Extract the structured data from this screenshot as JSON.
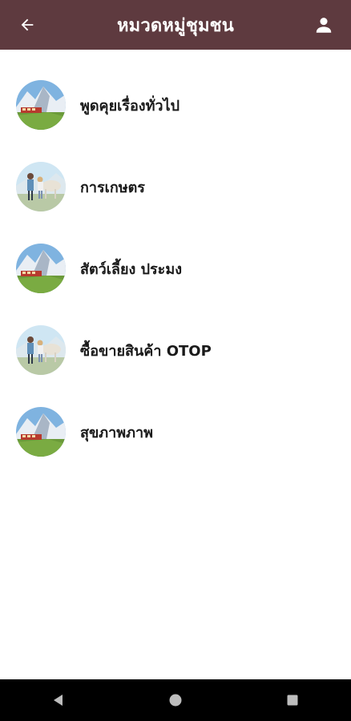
{
  "appbar": {
    "title": "หมวดหมู่ชุมชน",
    "back_icon": "arrow-left-icon",
    "profile_icon": "person-icon",
    "background": "#5e3a3f"
  },
  "categories": [
    {
      "label": "พูดคุยเรื่องทั่วไป",
      "image": "mountain-train-image"
    },
    {
      "label": "การเกษตร",
      "image": "people-horse-image"
    },
    {
      "label": "สัตว์เลี้ยง ประมง",
      "image": "mountain-train-image"
    },
    {
      "label": "ซื้อขายสินค้า OTOP",
      "image": "people-horse-image"
    },
    {
      "label": "สุขภาพภาพ",
      "image": "mountain-train-image"
    }
  ],
  "navbar": {
    "back_icon": "triangle-back-icon",
    "home_icon": "circle-home-icon",
    "recents_icon": "square-recents-icon"
  }
}
